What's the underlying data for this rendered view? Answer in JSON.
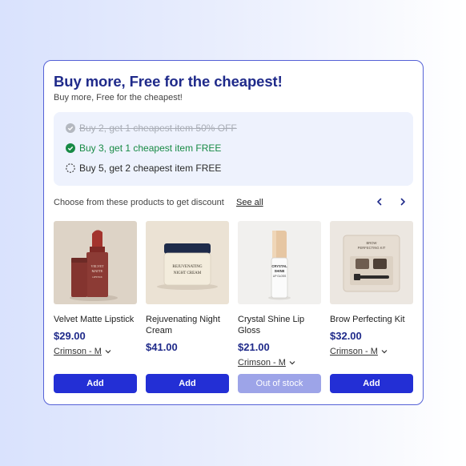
{
  "widget": {
    "title": "Buy more, Free for the cheapest!",
    "subtitle": "Buy more, Free for the cheapest!",
    "tiers": [
      {
        "label": "Buy 2, get 1 cheapest item 50% OFF",
        "state": "expired"
      },
      {
        "label": "Buy 3, get 1 cheapest item FREE",
        "state": "active"
      },
      {
        "label": "Buy 5, get 2 cheapest item FREE",
        "state": "pending"
      }
    ],
    "choose_text": "Choose from these products to get discount",
    "see_all_label": "See all",
    "colors": {
      "accent": "#232fd5",
      "title": "#1f2a8a",
      "success": "#188a45",
      "tier_bg": "#eef2fd"
    }
  },
  "products": [
    {
      "name": "Velvet Matte Lipstick",
      "price": "$29.00",
      "variant": "Crimson - M",
      "button": "Add",
      "image_icon": "lipstick",
      "image_text": [
        "VELVET",
        "MATTE",
        "LIPSTICK"
      ]
    },
    {
      "name": "Rejuvenating Night Cream",
      "price": "$41.00",
      "variant": "",
      "button": "Add",
      "image_icon": "cream-jar",
      "image_text": [
        "REJUVENATING",
        "NIGHT CREAM"
      ]
    },
    {
      "name": "Crystal Shine Lip Gloss",
      "price": "$21.00",
      "variant": "Crimson - M",
      "button": "Out of stock",
      "image_icon": "lip-gloss",
      "image_text": [
        "CRYSTAL",
        "SHINE",
        "LIP GLOSS"
      ]
    },
    {
      "name": "Brow Perfecting Kit",
      "price": "$32.00",
      "variant": "Crimson - M",
      "button": "Add",
      "image_icon": "brow-kit",
      "image_text": [
        "BROW",
        "PERFECTING KIT"
      ]
    }
  ]
}
